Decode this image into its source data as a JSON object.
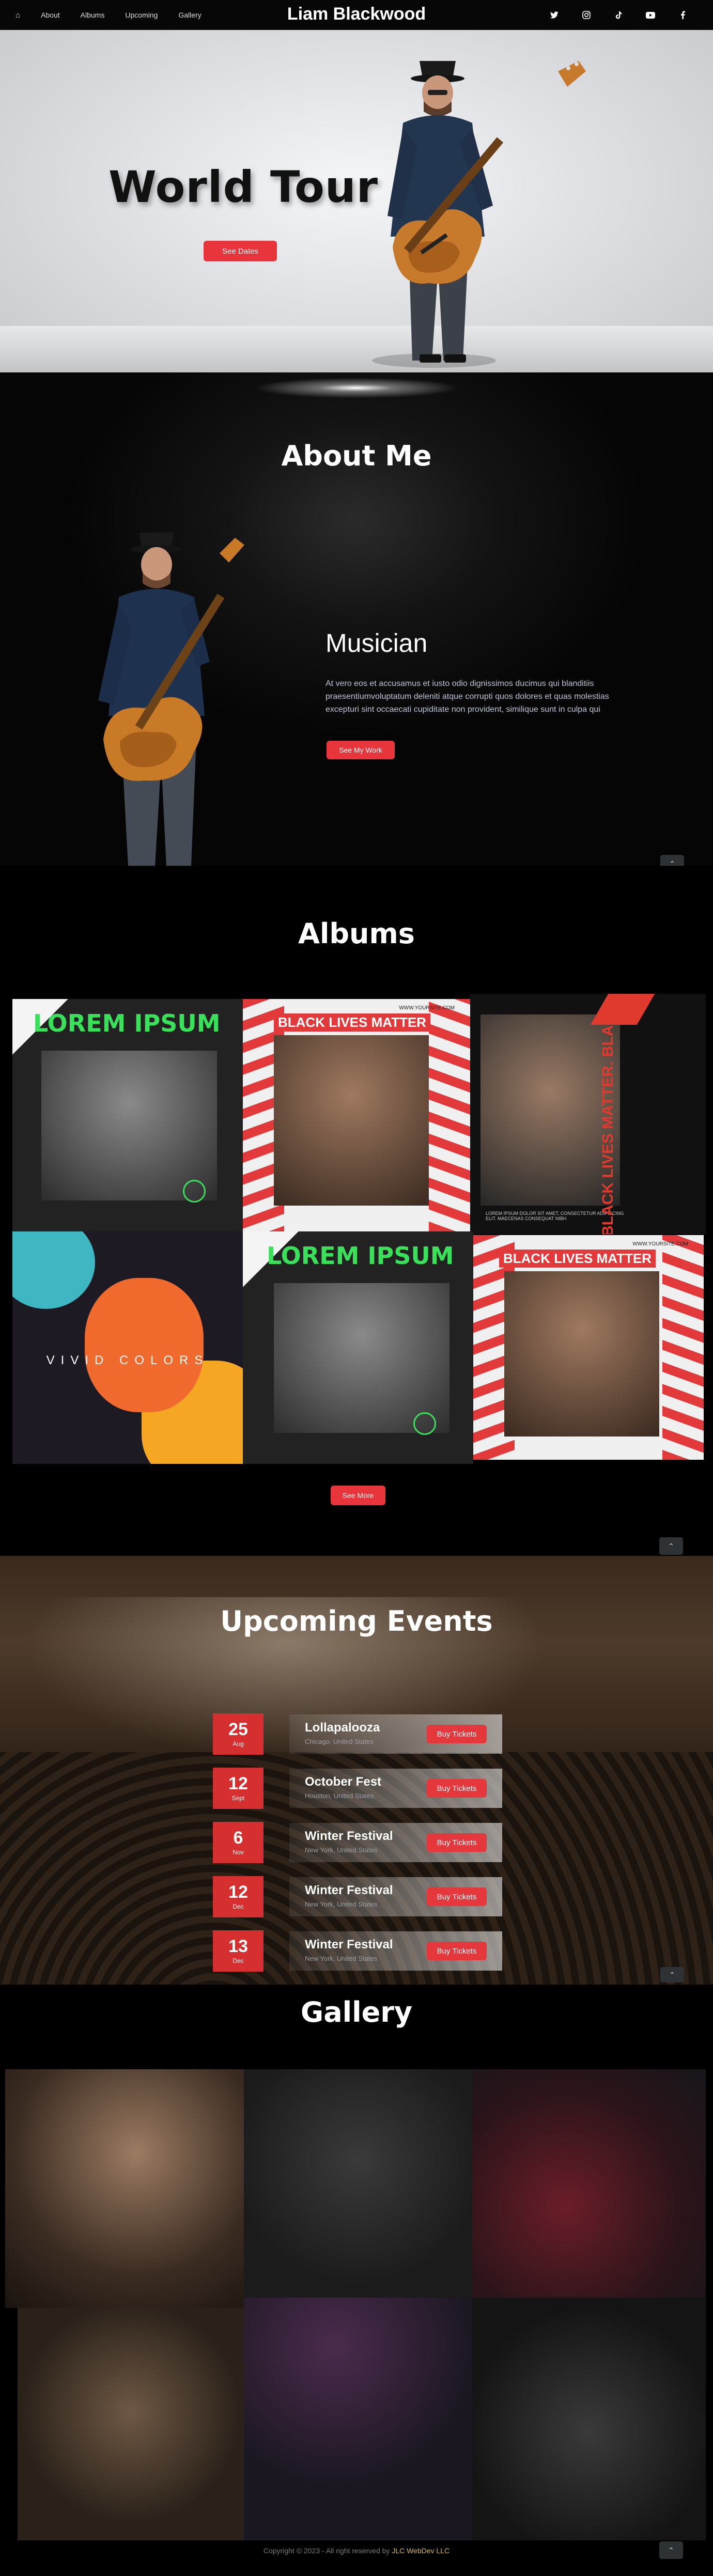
{
  "nav": {
    "home_icon": "home-icon",
    "links": [
      "About",
      "Albums",
      "Upcoming",
      "Gallery"
    ],
    "brand": "Liam Blackwood",
    "social": [
      "twitter-icon",
      "instagram-icon",
      "tiktok-icon",
      "youtube-icon",
      "facebook-icon"
    ]
  },
  "hero": {
    "title": "World Tour",
    "button": "See Dates"
  },
  "about": {
    "title": "About Me",
    "role": "Musician",
    "text": "At vero eos et accusamus et iusto odio dignissimos ducimus qui blanditiis praesentiumvoluptatum deleniti atque corrupti quos dolores et quas molestias excepturi sint occaecati cupiditate non provident, similique sunt in culpa qui",
    "button": "See My Work"
  },
  "albums": {
    "title": "Albums",
    "covers": [
      {
        "heading": "LOREM IPSUM",
        "style": "green"
      },
      {
        "heading": "BLACK LIVES MATTER",
        "site": "WWW.YOURSITE.COM",
        "style": "red"
      },
      {
        "heading": "BLACK LIVES MATTER. BLACK LIVES MATTER. BLACK LIVES MATTER.",
        "caption": "LOREM IPSUM DOLOR SIT AMET, CONSECTETUR ADIPISCING ELIT. MAECENAS CONSEQUAT NIBH",
        "style": "portrait"
      },
      {
        "heading": "VIVID COLORS",
        "style": "vivid"
      },
      {
        "heading": "LOREM IPSUM",
        "style": "green"
      },
      {
        "heading": "BLACK LIVES MATTER",
        "site": "WWW.YOURSITE.COM",
        "style": "red"
      }
    ],
    "button": "See More"
  },
  "events": {
    "title": "Upcoming Events",
    "items": [
      {
        "day": "25",
        "month": "Aug",
        "name": "Lollapalooza",
        "location": "Chicago, United States",
        "button": "Buy Tickets"
      },
      {
        "day": "12",
        "month": "Sept",
        "name": "October Fest",
        "location": "Houston, United States",
        "button": "Buy Tickets"
      },
      {
        "day": "6",
        "month": "Nov",
        "name": "Winter Festival",
        "location": "New York, United States",
        "button": "Buy Tickets"
      },
      {
        "day": "12",
        "month": "Dec",
        "name": "Winter Festival",
        "location": "New York, United States",
        "button": "Buy Tickets"
      },
      {
        "day": "13",
        "month": "Dec",
        "name": "Winter Festival",
        "location": "New York, United States",
        "button": "Buy Tickets"
      }
    ]
  },
  "gallery": {
    "title": "Gallery"
  },
  "footer": {
    "text": "Copyright © 2023 - All right reserved by ",
    "company": "JLC WebDev LLC"
  },
  "colors": {
    "accent": "#e8353c",
    "date_red": "#d62f2f",
    "album_green": "#39e05a"
  }
}
